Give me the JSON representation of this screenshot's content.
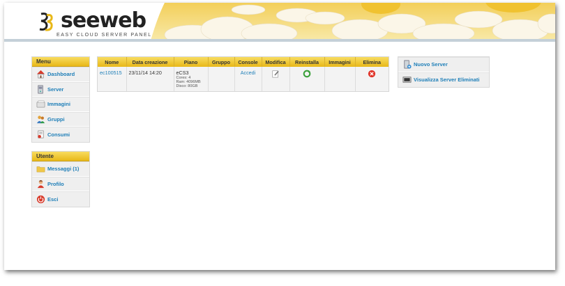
{
  "brand": {
    "name": "seeweb",
    "tagline": "EASY CLOUD SERVER PANEL"
  },
  "menu": {
    "title": "Menu",
    "items": [
      {
        "label": "Dashboard",
        "icon": "home-icon"
      },
      {
        "label": "Server",
        "icon": "server-icon"
      },
      {
        "label": "Immagini",
        "icon": "images-icon"
      },
      {
        "label": "Gruppi",
        "icon": "groups-icon"
      },
      {
        "label": "Consumi",
        "icon": "consumption-icon"
      }
    ]
  },
  "user": {
    "title": "Utente",
    "items": [
      {
        "label": "Messaggi (1)",
        "icon": "folder-icon"
      },
      {
        "label": "Profilo",
        "icon": "profile-icon"
      },
      {
        "label": "Esci",
        "icon": "power-icon"
      }
    ]
  },
  "table": {
    "headers": [
      "Nome",
      "Data creazione",
      "Piano",
      "Gruppo",
      "Console",
      "Modifica",
      "Reinstalla",
      "Immagini",
      "Elimina"
    ],
    "rows": [
      {
        "name": "ec100515",
        "created": "23/11/14 14:20",
        "plan": "eCS3",
        "plan_cores": "Cores: 4",
        "plan_ram": "Ram: 4096MB",
        "plan_disk": "Disco: 80GB",
        "group": "",
        "console": "Accedi"
      }
    ]
  },
  "actions": {
    "new_server": "Nuovo Server",
    "deleted_servers": "Visualizza Server Eliminati"
  },
  "colors": {
    "accent": "#e8b818",
    "link": "#1f7fb8",
    "band": "#c4d0d8"
  }
}
